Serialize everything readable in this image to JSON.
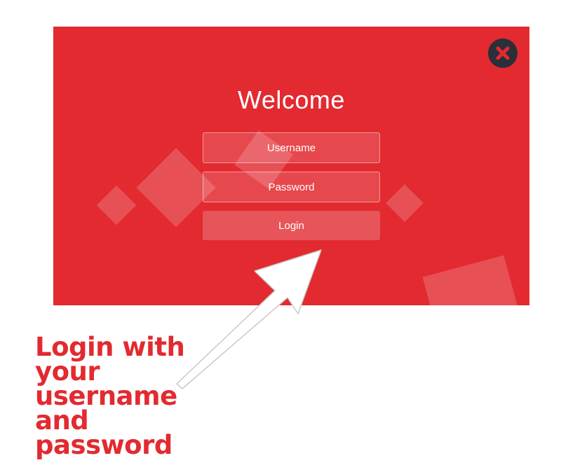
{
  "dialog": {
    "title": "Welcome",
    "username_placeholder": "Username",
    "password_placeholder": "Password",
    "login_label": "Login",
    "close_icon": "close-icon",
    "background_color": "#e22a30"
  },
  "annotation": {
    "caption_lines": [
      "Login with",
      "your",
      "username",
      "and",
      "password"
    ],
    "color": "#e22a30"
  }
}
